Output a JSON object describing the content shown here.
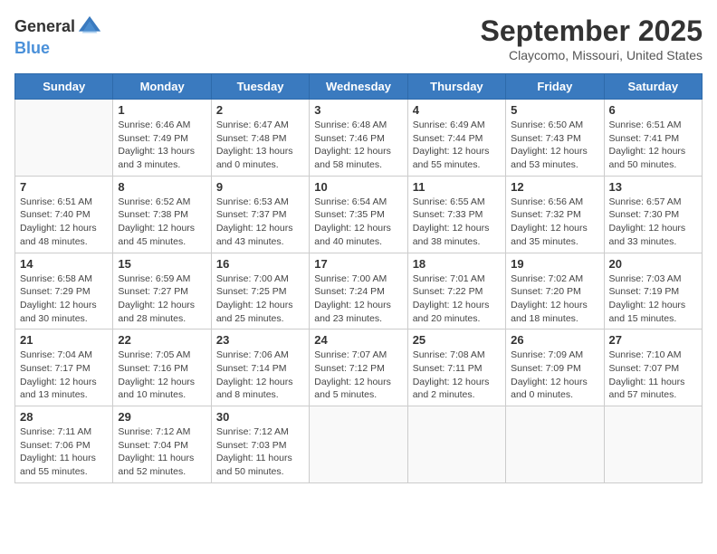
{
  "header": {
    "logo_general": "General",
    "logo_blue": "Blue",
    "month": "September 2025",
    "location": "Claycomo, Missouri, United States"
  },
  "weekdays": [
    "Sunday",
    "Monday",
    "Tuesday",
    "Wednesday",
    "Thursday",
    "Friday",
    "Saturday"
  ],
  "weeks": [
    [
      {
        "day": "",
        "sunrise": "",
        "sunset": "",
        "daylight": ""
      },
      {
        "day": "1",
        "sunrise": "Sunrise: 6:46 AM",
        "sunset": "Sunset: 7:49 PM",
        "daylight": "Daylight: 13 hours and 3 minutes."
      },
      {
        "day": "2",
        "sunrise": "Sunrise: 6:47 AM",
        "sunset": "Sunset: 7:48 PM",
        "daylight": "Daylight: 13 hours and 0 minutes."
      },
      {
        "day": "3",
        "sunrise": "Sunrise: 6:48 AM",
        "sunset": "Sunset: 7:46 PM",
        "daylight": "Daylight: 12 hours and 58 minutes."
      },
      {
        "day": "4",
        "sunrise": "Sunrise: 6:49 AM",
        "sunset": "Sunset: 7:44 PM",
        "daylight": "Daylight: 12 hours and 55 minutes."
      },
      {
        "day": "5",
        "sunrise": "Sunrise: 6:50 AM",
        "sunset": "Sunset: 7:43 PM",
        "daylight": "Daylight: 12 hours and 53 minutes."
      },
      {
        "day": "6",
        "sunrise": "Sunrise: 6:51 AM",
        "sunset": "Sunset: 7:41 PM",
        "daylight": "Daylight: 12 hours and 50 minutes."
      }
    ],
    [
      {
        "day": "7",
        "sunrise": "Sunrise: 6:51 AM",
        "sunset": "Sunset: 7:40 PM",
        "daylight": "Daylight: 12 hours and 48 minutes."
      },
      {
        "day": "8",
        "sunrise": "Sunrise: 6:52 AM",
        "sunset": "Sunset: 7:38 PM",
        "daylight": "Daylight: 12 hours and 45 minutes."
      },
      {
        "day": "9",
        "sunrise": "Sunrise: 6:53 AM",
        "sunset": "Sunset: 7:37 PM",
        "daylight": "Daylight: 12 hours and 43 minutes."
      },
      {
        "day": "10",
        "sunrise": "Sunrise: 6:54 AM",
        "sunset": "Sunset: 7:35 PM",
        "daylight": "Daylight: 12 hours and 40 minutes."
      },
      {
        "day": "11",
        "sunrise": "Sunrise: 6:55 AM",
        "sunset": "Sunset: 7:33 PM",
        "daylight": "Daylight: 12 hours and 38 minutes."
      },
      {
        "day": "12",
        "sunrise": "Sunrise: 6:56 AM",
        "sunset": "Sunset: 7:32 PM",
        "daylight": "Daylight: 12 hours and 35 minutes."
      },
      {
        "day": "13",
        "sunrise": "Sunrise: 6:57 AM",
        "sunset": "Sunset: 7:30 PM",
        "daylight": "Daylight: 12 hours and 33 minutes."
      }
    ],
    [
      {
        "day": "14",
        "sunrise": "Sunrise: 6:58 AM",
        "sunset": "Sunset: 7:29 PM",
        "daylight": "Daylight: 12 hours and 30 minutes."
      },
      {
        "day": "15",
        "sunrise": "Sunrise: 6:59 AM",
        "sunset": "Sunset: 7:27 PM",
        "daylight": "Daylight: 12 hours and 28 minutes."
      },
      {
        "day": "16",
        "sunrise": "Sunrise: 7:00 AM",
        "sunset": "Sunset: 7:25 PM",
        "daylight": "Daylight: 12 hours and 25 minutes."
      },
      {
        "day": "17",
        "sunrise": "Sunrise: 7:00 AM",
        "sunset": "Sunset: 7:24 PM",
        "daylight": "Daylight: 12 hours and 23 minutes."
      },
      {
        "day": "18",
        "sunrise": "Sunrise: 7:01 AM",
        "sunset": "Sunset: 7:22 PM",
        "daylight": "Daylight: 12 hours and 20 minutes."
      },
      {
        "day": "19",
        "sunrise": "Sunrise: 7:02 AM",
        "sunset": "Sunset: 7:20 PM",
        "daylight": "Daylight: 12 hours and 18 minutes."
      },
      {
        "day": "20",
        "sunrise": "Sunrise: 7:03 AM",
        "sunset": "Sunset: 7:19 PM",
        "daylight": "Daylight: 12 hours and 15 minutes."
      }
    ],
    [
      {
        "day": "21",
        "sunrise": "Sunrise: 7:04 AM",
        "sunset": "Sunset: 7:17 PM",
        "daylight": "Daylight: 12 hours and 13 minutes."
      },
      {
        "day": "22",
        "sunrise": "Sunrise: 7:05 AM",
        "sunset": "Sunset: 7:16 PM",
        "daylight": "Daylight: 12 hours and 10 minutes."
      },
      {
        "day": "23",
        "sunrise": "Sunrise: 7:06 AM",
        "sunset": "Sunset: 7:14 PM",
        "daylight": "Daylight: 12 hours and 8 minutes."
      },
      {
        "day": "24",
        "sunrise": "Sunrise: 7:07 AM",
        "sunset": "Sunset: 7:12 PM",
        "daylight": "Daylight: 12 hours and 5 minutes."
      },
      {
        "day": "25",
        "sunrise": "Sunrise: 7:08 AM",
        "sunset": "Sunset: 7:11 PM",
        "daylight": "Daylight: 12 hours and 2 minutes."
      },
      {
        "day": "26",
        "sunrise": "Sunrise: 7:09 AM",
        "sunset": "Sunset: 7:09 PM",
        "daylight": "Daylight: 12 hours and 0 minutes."
      },
      {
        "day": "27",
        "sunrise": "Sunrise: 7:10 AM",
        "sunset": "Sunset: 7:07 PM",
        "daylight": "Daylight: 11 hours and 57 minutes."
      }
    ],
    [
      {
        "day": "28",
        "sunrise": "Sunrise: 7:11 AM",
        "sunset": "Sunset: 7:06 PM",
        "daylight": "Daylight: 11 hours and 55 minutes."
      },
      {
        "day": "29",
        "sunrise": "Sunrise: 7:12 AM",
        "sunset": "Sunset: 7:04 PM",
        "daylight": "Daylight: 11 hours and 52 minutes."
      },
      {
        "day": "30",
        "sunrise": "Sunrise: 7:12 AM",
        "sunset": "Sunset: 7:03 PM",
        "daylight": "Daylight: 11 hours and 50 minutes."
      },
      {
        "day": "",
        "sunrise": "",
        "sunset": "",
        "daylight": ""
      },
      {
        "day": "",
        "sunrise": "",
        "sunset": "",
        "daylight": ""
      },
      {
        "day": "",
        "sunrise": "",
        "sunset": "",
        "daylight": ""
      },
      {
        "day": "",
        "sunrise": "",
        "sunset": "",
        "daylight": ""
      }
    ]
  ]
}
